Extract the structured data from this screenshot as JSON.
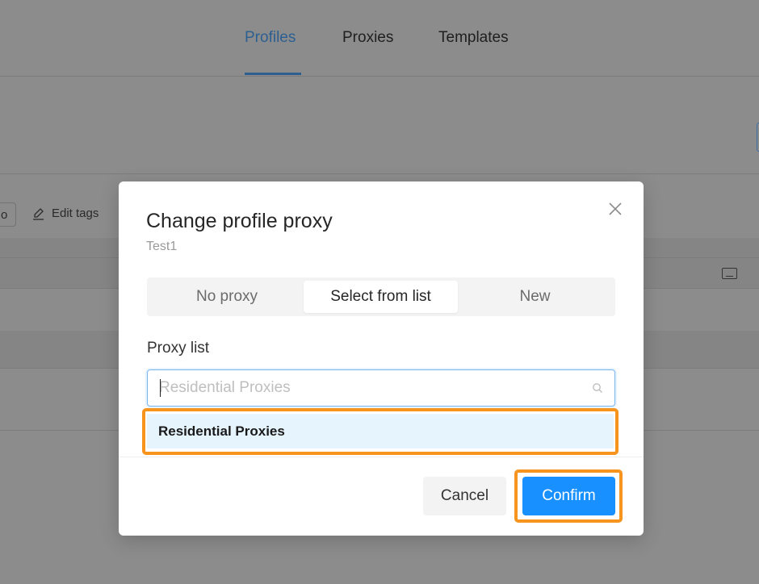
{
  "nav": {
    "tabs": [
      {
        "label": "Profiles",
        "active": true
      },
      {
        "label": "Proxies",
        "active": false
      },
      {
        "label": "Templates",
        "active": false
      }
    ]
  },
  "background": {
    "partial_button_label": "o",
    "edit_tags_label": "Edit tags"
  },
  "modal": {
    "title": "Change profile proxy",
    "subtitle": "Test1",
    "proxy_mode_tabs": [
      {
        "label": "No proxy",
        "selected": false
      },
      {
        "label": "Select from list",
        "selected": true
      },
      {
        "label": "New",
        "selected": false
      }
    ],
    "proxy_list_label": "Proxy list",
    "search": {
      "value": "",
      "placeholder": "Residential Proxies"
    },
    "dropdown_options": [
      {
        "label": "Residential Proxies",
        "highlighted": true
      }
    ],
    "cancel_label": "Cancel",
    "confirm_label": "Confirm"
  },
  "colors": {
    "accent": "#1890ff",
    "active_tab": "#2d5f91",
    "highlight_annotation": "#f7941d",
    "dropdown_hover": "#e6f4fd",
    "overlay": "#8c8c8c"
  }
}
